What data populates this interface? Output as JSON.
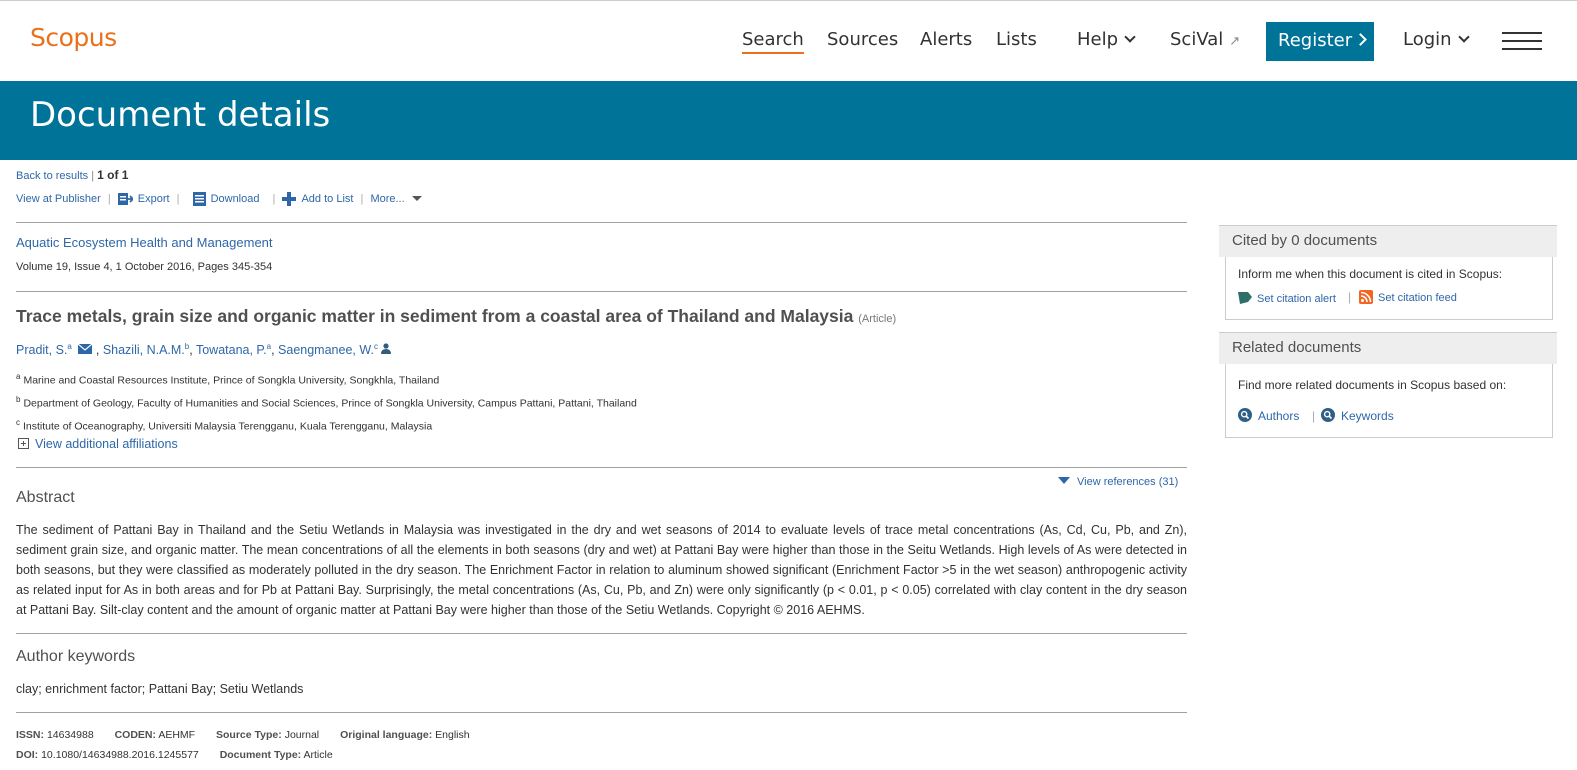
{
  "header": {
    "logo": "Scopus",
    "nav": {
      "search": "Search",
      "sources": "Sources",
      "alerts": "Alerts",
      "lists": "Lists",
      "help": "Help",
      "scival": "SciVal",
      "register": "Register",
      "login": "Login"
    }
  },
  "banner": {
    "title": "Document details"
  },
  "toolbar": {
    "back": "Back to results",
    "counter": "1 of 1",
    "view_publisher": "View at Publisher",
    "export": "Export",
    "download": "Download",
    "add_to_list": "Add to List",
    "more": "More..."
  },
  "document": {
    "journal": "Aquatic Ecosystem Health and Management",
    "volume": "Volume 19, Issue 4, 1 October 2016, Pages 345-354",
    "title": "Trace metals, grain size and organic matter in sediment from a coastal area of Thailand and Malaysia",
    "type": "(Article)",
    "authors": [
      {
        "name": "Pradit, S.",
        "sup": "a"
      },
      {
        "name": "Shazili, N.A.M.",
        "sup": "b"
      },
      {
        "name": "Towatana, P.",
        "sup": "a"
      },
      {
        "name": "Saengmanee, W.",
        "sup": "c"
      }
    ],
    "affiliations": [
      {
        "sup": "a",
        "text": "Marine and Coastal Resources Institute, Prince of Songkla University, Songkhla, Thailand"
      },
      {
        "sup": "b",
        "text": "Department of Geology, Faculty of Humanities and Social Sciences, Prince of Songkla University, Campus Pattani, Pattani, Thailand"
      },
      {
        "sup": "c",
        "text": "Institute of Oceanography, Universiti Malaysia Terengganu, Kuala Terengganu, Malaysia"
      }
    ],
    "view_affiliations": "View additional affiliations"
  },
  "abstract": {
    "heading": "Abstract",
    "view_references": "View references (31)",
    "text": "The sediment of Pattani Bay in Thailand and the Setiu Wetlands in Malaysia was investigated in the dry and wet seasons of 2014 to evaluate levels of trace metal concentrations (As, Cd, Cu, Pb, and Zn), sediment grain size, and organic matter. The mean concentrations of all the elements in both seasons (dry and wet) at Pattani Bay were higher than those in the Seitu Wetlands. High levels of As were detected in both seasons, but they were classified as moderately polluted in the dry season. The Enrichment Factor in relation to aluminum showed significant (Enrichment Factor >5 in the wet season) anthropogenic activity as related input for As in both areas and for Pb at Pattani Bay. Surprisingly, the metal concentrations (As, Cu, Pb, and Zn) were only significantly (p < 0.01, p < 0.05) correlated with clay content in the dry season at Pattani Bay. Silt-clay content and the amount of organic matter at Pattani Bay were higher than those of the Setiu Wetlands. Copyright © 2016 AEHMS."
  },
  "keywords": {
    "heading": "Author keywords",
    "text": "clay; enrichment factor; Pattani Bay; Setiu Wetlands"
  },
  "meta": {
    "issn_label": "ISSN:",
    "issn": "14634988",
    "coden_label": "CODEN:",
    "coden": "AEHMF",
    "source_type_label": "Source Type:",
    "source_type": "Journal",
    "language_label": "Original language:",
    "language": "English",
    "doi_label": "DOI:",
    "doi": "10.1080/14634988.2016.1245577",
    "doctype_label": "Document Type:",
    "doctype": "Article"
  },
  "sidebar": {
    "cited": {
      "heading": "Cited by 0 documents",
      "text": "Inform me when this document is cited in Scopus:",
      "alert": "Set citation alert",
      "feed": "Set citation feed"
    },
    "related": {
      "heading": "Related documents",
      "text": "Find more related documents in Scopus based on:",
      "authors": "Authors",
      "keywords": "Keywords"
    }
  },
  "colors": {
    "brand_orange": "#e9711c",
    "brand_blue": "#007398",
    "link": "#2e67a7"
  }
}
